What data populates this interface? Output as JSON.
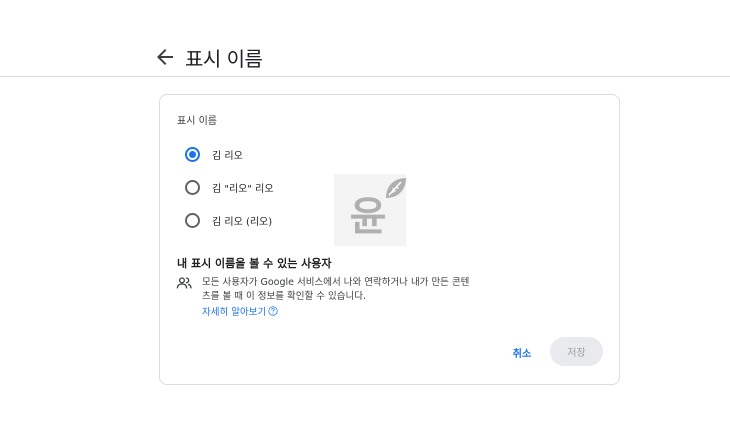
{
  "header": {
    "back_icon": "arrow-back-icon",
    "title": "표시 이름"
  },
  "card": {
    "section_label": "표시 이름",
    "options": [
      {
        "label": "김 리오",
        "selected": true
      },
      {
        "label": "김 \"리오\" 리오",
        "selected": false
      },
      {
        "label": "김 리오 (리오)",
        "selected": false
      }
    ],
    "logo": {
      "icon": "yoon-leaf-logo",
      "glyph": "윤",
      "color": "#b0b0b0"
    },
    "who": {
      "title": "내 표시 이름을 볼 수 있는 사용자",
      "icon": "people-icon",
      "description": "모든 사용자가 Google 서비스에서 나와 연락하거나 내가 만든 콘텐츠를 볼 때 이 정보를 확인할 수 있습니다.",
      "learn_more": "자세히 알아보기",
      "learn_more_icon": "help-icon"
    },
    "actions": {
      "cancel_label": "취소",
      "save_label": "저장",
      "save_enabled": false
    }
  },
  "colors": {
    "accent": "#1a73e8",
    "text": "#202124",
    "border": "#dadce0",
    "disabled_bg": "#e8eaed",
    "disabled_text": "#9aa0a6"
  }
}
